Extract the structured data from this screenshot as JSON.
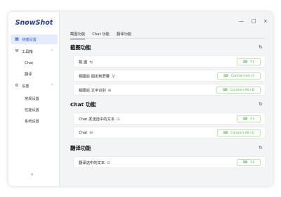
{
  "app": {
    "brand": "SnowShot"
  },
  "sidebar": {
    "items": [
      {
        "label": "快捷设置",
        "icon": "grid-icon"
      },
      {
        "label": "工具箱",
        "icon": "wrench-icon"
      },
      {
        "label": "Chat"
      },
      {
        "label": "翻译"
      },
      {
        "label": "设置",
        "icon": "gear-icon"
      },
      {
        "label": "常规设置"
      },
      {
        "label": "性能设置"
      },
      {
        "label": "系统设置"
      }
    ]
  },
  "window_controls": {
    "minimize": "—",
    "maximize": "□",
    "close": "×"
  },
  "tabs": [
    "截图功能",
    "Chat 功能",
    "翻译功能"
  ],
  "sections": [
    {
      "title": "截图功能",
      "rows": [
        {
          "label": "截 图",
          "glyph": "⇆",
          "shortcut": "F1"
        },
        {
          "label": "截图后 固定到屏幕",
          "glyph": "⚲",
          "shortcut": "Control+Alt+F"
        },
        {
          "label": "截图后 文字识别",
          "glyph": "⊞",
          "shortcut": "Control+Alt+D"
        }
      ]
    },
    {
      "title": "Chat 功能",
      "rows": [
        {
          "label": "Chat 发送选中的文本",
          "glyph": "⊡",
          "shortcut": "F3"
        },
        {
          "label": "Chat",
          "glyph": "⊟",
          "shortcut": "Control+Alt+C"
        }
      ]
    },
    {
      "title": "翻译功能",
      "rows": [
        {
          "label": "翻译选中的文本",
          "glyph": "⊡",
          "shortcut": "F4"
        }
      ]
    }
  ],
  "key_icon": "⌨",
  "reset_icon": "↻"
}
